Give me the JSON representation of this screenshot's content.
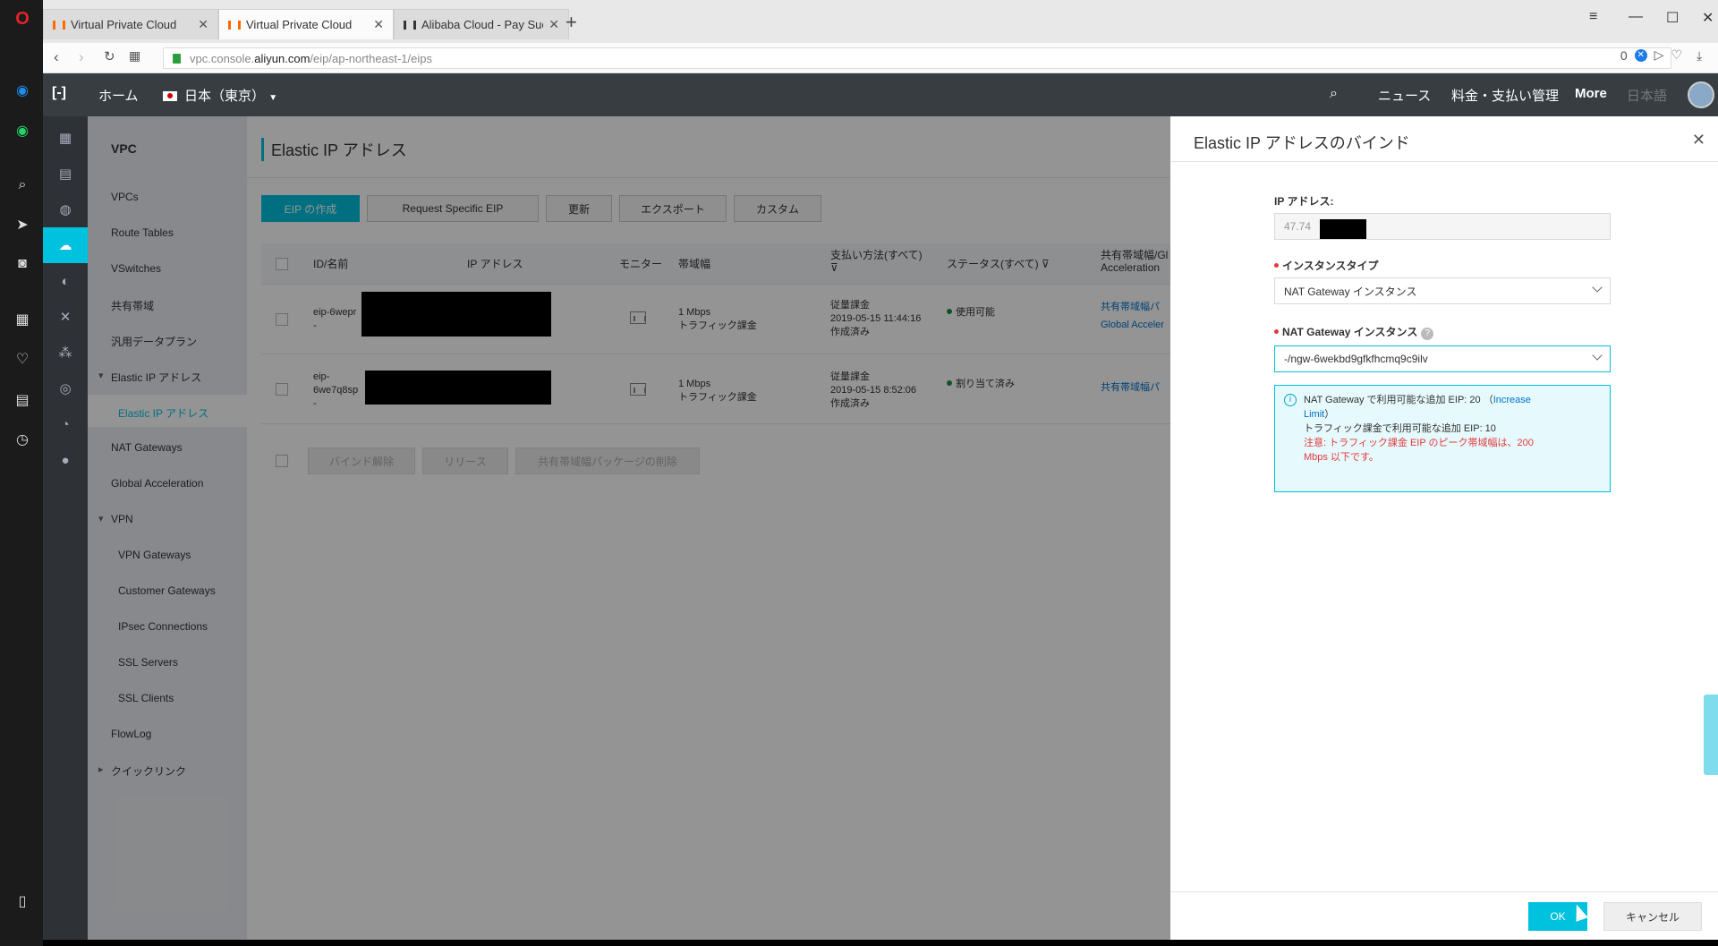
{
  "browser": {
    "tabs": [
      {
        "title": "Virtual Private Cloud",
        "active": false
      },
      {
        "title": "Virtual Private Cloud",
        "active": true
      },
      {
        "title": "Alibaba Cloud - Pay Succe",
        "active": false
      }
    ],
    "url_prefix": "vpc.console.",
    "url_domain": "aliyun.com",
    "url_path": "/eip/ap-northeast-1/eips",
    "blocked_count": "0"
  },
  "console_header": {
    "home": "ホーム",
    "region": "日本（東京）",
    "news": "ニュース",
    "billing": "料金・支払い管理",
    "more": "More",
    "language": "日本語"
  },
  "sidenav": {
    "title": "VPC",
    "items": [
      "VPCs",
      "Route Tables",
      "VSwitches",
      "共有帯域",
      "汎用データプラン",
      "Elastic IP アドレス",
      "Elastic IP アドレス",
      "NAT Gateways",
      "Global Acceleration",
      "VPN",
      "VPN Gateways",
      "Customer Gateways",
      "IPsec Connections",
      "SSL Servers",
      "SSL Clients",
      "FlowLog",
      "クイックリンク"
    ]
  },
  "main": {
    "title": "Elastic IP アドレス",
    "toolbar": {
      "create": "EIP の作成",
      "request": "Request Specific EIP",
      "refresh": "更新",
      "export": "エクスポート",
      "custom": "カスタム"
    },
    "columns": {
      "id": "ID/名前",
      "ip": "IP アドレス",
      "monitor": "モニター",
      "bandwidth": "帯域幅",
      "billing": "支払い方法(すべて)",
      "status": "ステータス(すべて)",
      "shared_1": "共有帯域幅/Gl",
      "shared_2": "Acceleration"
    },
    "rows": [
      {
        "id_1": "eip-6wepr",
        "id_2": "-",
        "id_3": "",
        "bw_1": "1 Mbps",
        "bw_2": "トラフィック課金",
        "billing_1": "従量課金",
        "billing_2": "2019-05-15 11:44:16",
        "billing_3": "作成済み",
        "status": "使用可能",
        "shared_1": "共有帯域幅パ",
        "shared_2": "Global Acceler"
      },
      {
        "id_1": "eip-",
        "id_2": "6we7q8sp",
        "id_3": "-",
        "bw_1": "1 Mbps",
        "bw_2": "トラフィック課金",
        "billing_1": "従量課金",
        "billing_2": "2019-05-15 8:52:06",
        "billing_3": "作成済み",
        "status": "割り当て済み",
        "shared_1": "共有帯域幅パ",
        "shared_2": ""
      }
    ],
    "footer": {
      "unbind": "バインド解除",
      "release": "リリース",
      "remove_shared": "共有帯域幅パッケージの削除"
    }
  },
  "drawer": {
    "title": "Elastic IP アドレスのバインド",
    "ip_label": "IP アドレス:",
    "ip_value": "47.74",
    "instance_type_label": "インスタンスタイプ",
    "instance_type_value": "NAT Gateway インスタンス",
    "nat_label": "NAT Gateway インスタンス",
    "nat_value": "-/ngw-6wekbd9gfkfhcmq9c9ilv",
    "info_line1": "NAT Gateway で利用可能な追加 EIP: 20  （",
    "info_link1": "Increase",
    "info_link2": "Limit",
    "info_line2_suffix": "）",
    "info_line3": "トラフィック課金で利用可能な追加 EIP: 10",
    "info_warn1": "注意: トラフィック課金 EIP のピーク帯域幅は、200",
    "info_warn2": "Mbps 以下です。",
    "ok": "OK",
    "cancel": "キャンセル"
  },
  "colors": {
    "accent": "#00c1de",
    "header_bg": "#373d41",
    "link": "#0070cc",
    "warning": "#e4393c"
  }
}
